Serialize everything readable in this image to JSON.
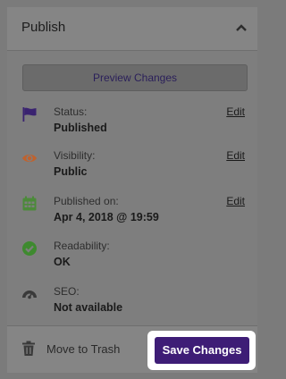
{
  "header": {
    "title": "Publish"
  },
  "preview_button": {
    "label": "Preview Changes"
  },
  "rows": [
    {
      "label": "Status:",
      "value": "Published",
      "edit": "Edit",
      "icon": "flag-icon"
    },
    {
      "label": "Visibility:",
      "value": "Public",
      "edit": "Edit",
      "icon": "eye-icon"
    },
    {
      "label": "Published on:",
      "value": "Apr 4, 2018 @ 19:59",
      "edit": "Edit",
      "icon": "calendar-icon"
    },
    {
      "label": "Readability:",
      "value": "OK",
      "icon": "check-circle-icon"
    },
    {
      "label": "SEO:",
      "value": "Not available",
      "icon": "gauge-icon"
    }
  ],
  "footer": {
    "trash_label": "Move to Trash",
    "save_label": "Save Changes"
  },
  "colors": {
    "primary_button": "#3e1d76",
    "flag": "#3a2370",
    "eye": "#c0622e",
    "calendar": "#4c8a3a",
    "check": "#3e8a2f"
  }
}
